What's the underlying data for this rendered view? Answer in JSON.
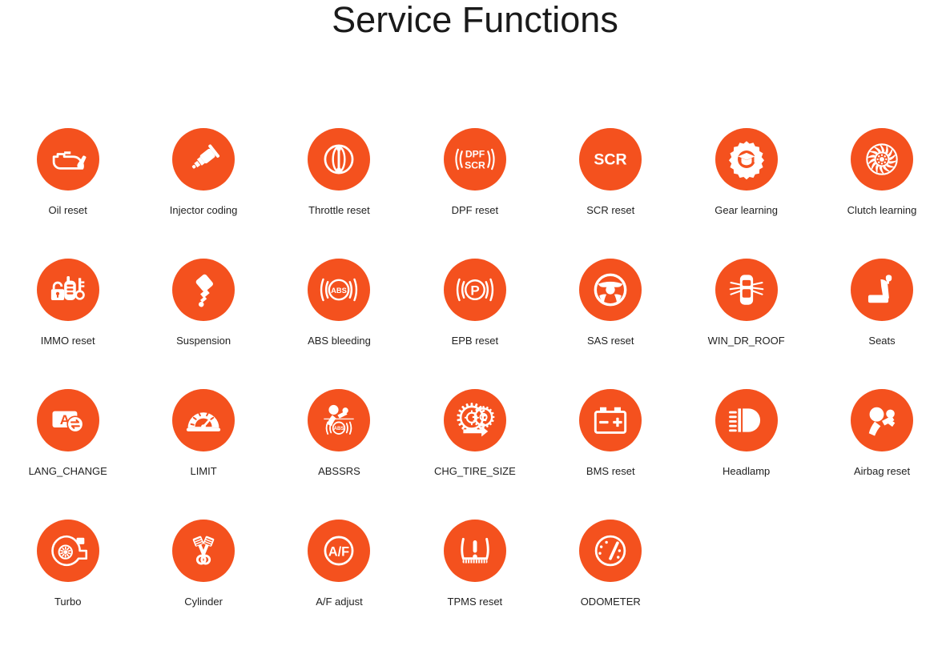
{
  "page": {
    "title": "Service Functions",
    "accent_color": "#f4511e",
    "icon_color": "#ffffff",
    "background_color": "#ffffff",
    "label_color": "#222222",
    "columns": 7
  },
  "functions": [
    {
      "label": "Oil reset",
      "icon": "oil-can-icon"
    },
    {
      "label": "Injector coding",
      "icon": "fuel-injector-icon"
    },
    {
      "label": "Throttle reset",
      "icon": "throttle-body-icon"
    },
    {
      "label": "DPF reset",
      "icon": "dpf-scr-text-icon",
      "icon_text": [
        "DPF",
        "SCR"
      ]
    },
    {
      "label": "SCR reset",
      "icon": "scr-text-icon",
      "icon_text": [
        "SCR"
      ]
    },
    {
      "label": "Gear learning",
      "icon": "gear-graduation-cap-icon"
    },
    {
      "label": "Clutch learning",
      "icon": "clutch-disc-icon"
    },
    {
      "label": "IMMO reset",
      "icon": "immobilizer-lock-key-icon"
    },
    {
      "label": "Suspension",
      "icon": "shock-absorber-icon"
    },
    {
      "label": "ABS bleeding",
      "icon": "abs-warning-icon",
      "icon_text": [
        "ABS"
      ]
    },
    {
      "label": "EPB reset",
      "icon": "parking-brake-p-icon",
      "icon_text": [
        "P"
      ]
    },
    {
      "label": "SAS reset",
      "icon": "steering-wheel-icon"
    },
    {
      "label": "WIN_DR_ROOF",
      "icon": "car-doors-roof-icon"
    },
    {
      "label": "Seats",
      "icon": "car-seat-icon"
    },
    {
      "label": "LANG_CHANGE",
      "icon": "language-exchange-icon",
      "icon_text": [
        "A"
      ]
    },
    {
      "label": "LIMIT",
      "icon": "speed-limit-gauge-icon"
    },
    {
      "label": "ABSSRS",
      "icon": "airbag-abs-combined-icon",
      "icon_text": [
        "ABS"
      ]
    },
    {
      "label": "CHG_TIRE_SIZE",
      "icon": "change-tire-size-icon"
    },
    {
      "label": "BMS reset",
      "icon": "battery-icon"
    },
    {
      "label": "Headlamp",
      "icon": "headlamp-beam-icon"
    },
    {
      "label": "Airbag reset",
      "icon": "airbag-person-icon"
    },
    {
      "label": "Turbo",
      "icon": "turbocharger-icon"
    },
    {
      "label": "Cylinder",
      "icon": "crossed-pistons-icon"
    },
    {
      "label": "A/F adjust",
      "icon": "air-fuel-ratio-icon",
      "icon_text": [
        "A/F"
      ]
    },
    {
      "label": "TPMS reset",
      "icon": "tire-pressure-warning-icon"
    },
    {
      "label": "ODOMETER",
      "icon": "odometer-gauge-icon"
    }
  ]
}
